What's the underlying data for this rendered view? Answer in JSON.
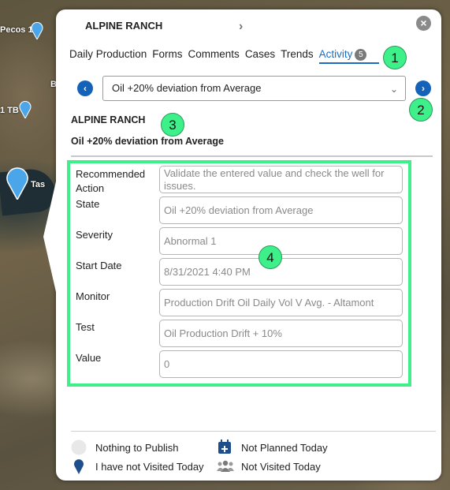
{
  "map": {
    "labels": [
      "Pecos 1",
      "1 TB",
      "B",
      "Tas"
    ]
  },
  "panel": {
    "title": "ALPINE RANCH",
    "title_chevron": "›",
    "close_glyph": "×"
  },
  "tabs": [
    {
      "label": "Daily Production"
    },
    {
      "label": "Forms"
    },
    {
      "label": "Comments"
    },
    {
      "label": "Cases"
    },
    {
      "label": "Trends"
    },
    {
      "label": "Activity",
      "badge": "5"
    }
  ],
  "nav": {
    "prev_glyph": "‹",
    "next_glyph": "›"
  },
  "select": {
    "value": "Oil +20% deviation from Average",
    "chevron": "⌄"
  },
  "section": {
    "title": "ALPINE RANCH",
    "subtitle": "Oil +20% deviation from Average"
  },
  "fields": [
    {
      "label": "Recommended Action",
      "value": "Validate the entered value and check the well for issues."
    },
    {
      "label": "State",
      "value": "Oil +20% deviation from Average"
    },
    {
      "label": "Severity",
      "value": "Abnormal 1"
    },
    {
      "label": "Start Date",
      "value": "8/31/2021 4:40 PM"
    },
    {
      "label": "Monitor",
      "value": "Production Drift Oil Daily Vol V Avg. - Altamont"
    },
    {
      "label": "Test",
      "value": "Oil Production Drift + 10%"
    },
    {
      "label": "Value",
      "value": "0"
    }
  ],
  "legend": {
    "nothing_to_publish": "Nothing to Publish",
    "not_visited_today_pin": "I have not Visited Today",
    "not_planned_today": "Not Planned Today",
    "not_visited_today_group": "Not Visited Today"
  },
  "callouts": [
    "1",
    "2",
    "3",
    "4"
  ],
  "colors": {
    "accent": "#1a6cc2",
    "nav_button": "#1563b8",
    "callout": "#3df08a",
    "pin": "#4aa6e8",
    "legend_icon": "#1d4f8c"
  }
}
